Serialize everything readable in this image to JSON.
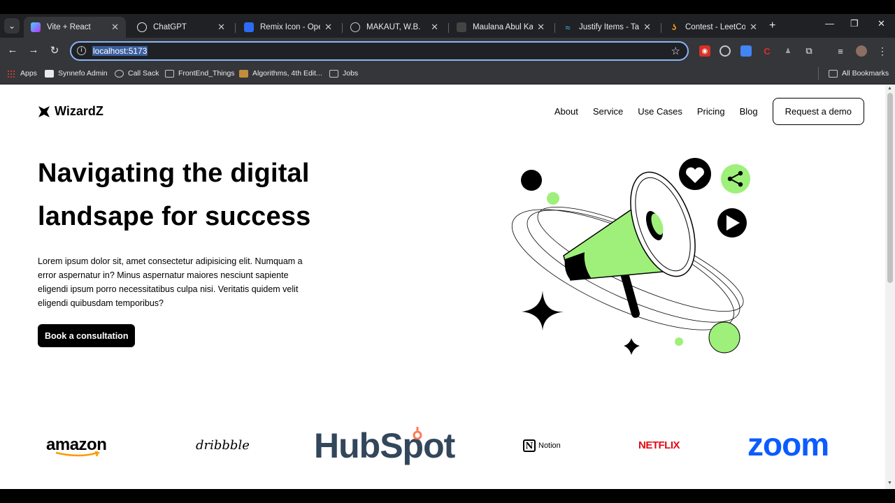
{
  "browser": {
    "tabs": [
      {
        "title": "Vite + React",
        "active": true,
        "favicon": "vite-icon"
      },
      {
        "title": "ChatGPT",
        "active": false,
        "favicon": "chatgpt-icon"
      },
      {
        "title": "Remix Icon - Open s",
        "active": false,
        "favicon": "remix-icon"
      },
      {
        "title": "MAKAUT, W.B.",
        "active": false,
        "favicon": "globe-icon"
      },
      {
        "title": "Maulana Abul Kalam",
        "active": false,
        "favicon": "page-icon"
      },
      {
        "title": "Justify Items - Tailwi",
        "active": false,
        "favicon": "tailwind-icon"
      },
      {
        "title": "Contest - LeetCode",
        "active": false,
        "favicon": "leetcode-icon"
      }
    ],
    "url": "localhost:5173",
    "bookmarks": [
      {
        "label": "Apps",
        "icon": "apps-grid-icon"
      },
      {
        "label": "Synnefo Admin",
        "icon": "synnefo-icon"
      },
      {
        "label": "Call Sack",
        "icon": "globe-icon"
      },
      {
        "label": "FrontEnd_Things",
        "icon": "folder-icon"
      },
      {
        "label": "Algorithms, 4th Edit...",
        "icon": "book-icon"
      },
      {
        "label": "Jobs",
        "icon": "folder-icon"
      }
    ],
    "all_bookmarks_label": "All Bookmarks",
    "accent": "#8ab4f8"
  },
  "page": {
    "logo_text": "WizardZ",
    "nav": {
      "about": "About",
      "service": "Service",
      "use_cases": "Use Cases",
      "pricing": "Pricing",
      "blog": "Blog",
      "request_demo": "Request a demo"
    },
    "hero": {
      "title_line1": "Navigating the digital",
      "title_line2": "landsape for success",
      "body": "Lorem ipsum dolor sit, amet consectetur adipisicing elit. Numquam a error aspernatur in? Minus aspernatur maiores nesciunt sapiente eligendi ipsum porro necessitatibus culpa nisi. Veritatis quidem velit eligendi quibusdam temporibus?",
      "cta": "Book a consultation"
    },
    "brands": {
      "amazon": "amazon",
      "dribbble": "dribbble",
      "hubspot": "HubSpot",
      "notion": "Notion",
      "netflix": "NETFLIX",
      "zoom": "zoom"
    },
    "accent_green": "#9ef07a"
  }
}
